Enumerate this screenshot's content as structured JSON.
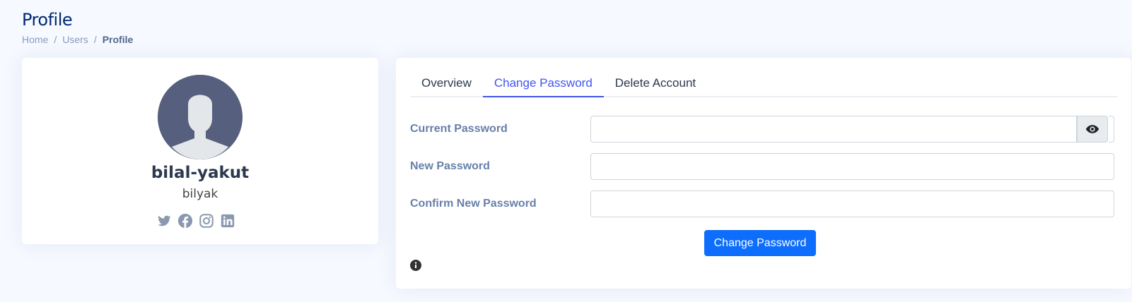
{
  "page": {
    "title": "Profile",
    "breadcrumb": [
      "Home",
      "Users",
      "Profile"
    ],
    "breadcrumb_separator": "/"
  },
  "profile": {
    "name": "bilal-yakut",
    "username": "bilyak",
    "social_icons": [
      "twitter-icon",
      "facebook-icon",
      "instagram-icon",
      "linkedin-icon"
    ]
  },
  "tabs": [
    {
      "label": "Overview",
      "active": false
    },
    {
      "label": "Change Password",
      "active": true
    },
    {
      "label": "Delete Account",
      "active": false
    }
  ],
  "form": {
    "current_password": {
      "label": "Current Password",
      "value": ""
    },
    "new_password": {
      "label": "New Password",
      "value": ""
    },
    "confirm_password": {
      "label": "Confirm New Password",
      "value": ""
    },
    "submit_label": "Change Password",
    "toggle_icon": "eye-icon",
    "info_icon": "info-icon"
  },
  "colors": {
    "accent": "#4154f1",
    "button": "#0d6efd",
    "title": "#012970",
    "background": "#f6f9ff"
  }
}
